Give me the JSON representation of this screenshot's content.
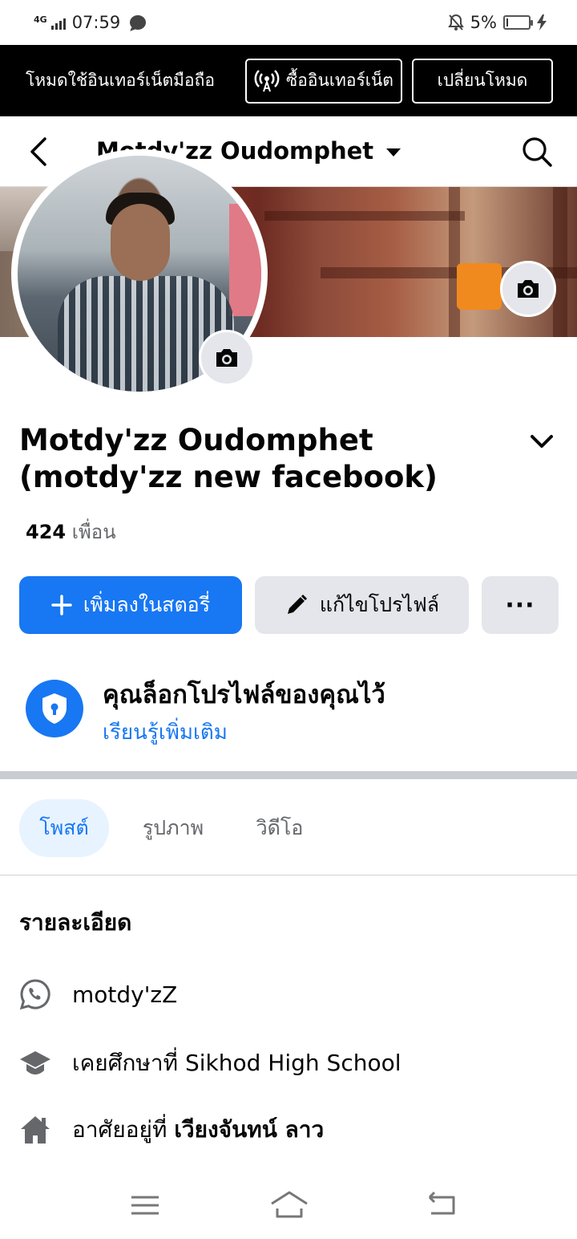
{
  "status_bar": {
    "network": "4G",
    "time": "07:59",
    "battery_percent": "5%",
    "battery_level": 0.05
  },
  "data_banner": {
    "mode_text": "โหมดใช้อินเทอร์เน็ตมือถือ",
    "buy_label": "ซื้ออินเทอร์เน็ต",
    "switch_label": "เปลี่ยนโหมด"
  },
  "top_nav": {
    "title": "Motdy'zz Oudomphet"
  },
  "profile": {
    "name": "Motdy'zz Oudomphet (motdy'zz new facebook)",
    "friends_count": "424",
    "friends_label": "เพื่อน"
  },
  "actions": {
    "add_story": "เพิ่มลงในสตอรี่",
    "edit_profile": "แก้ไขโปรไฟล์",
    "more": "···"
  },
  "lock_notice": {
    "title": "คุณล็อกโปรไฟล์ของคุณไว้",
    "link": "เรียนรู้เพิ่มเติม"
  },
  "tabs": [
    {
      "label": "โพสต์",
      "active": true
    },
    {
      "label": "รูปภาพ",
      "active": false
    },
    {
      "label": "วิดีโอ",
      "active": false
    }
  ],
  "details": {
    "title": "รายละเอียด",
    "whatsapp": "motdy'zZ",
    "education": "เคยศึกษาที่ Sikhod High School",
    "lives_prefix": "อาศัยอยู่ที่",
    "lives_place": "เวียงจันทน์ ลาว"
  },
  "colors": {
    "accent": "#1877f2",
    "banner_bg": "#000000",
    "secondary_button": "#e4e6eb"
  }
}
